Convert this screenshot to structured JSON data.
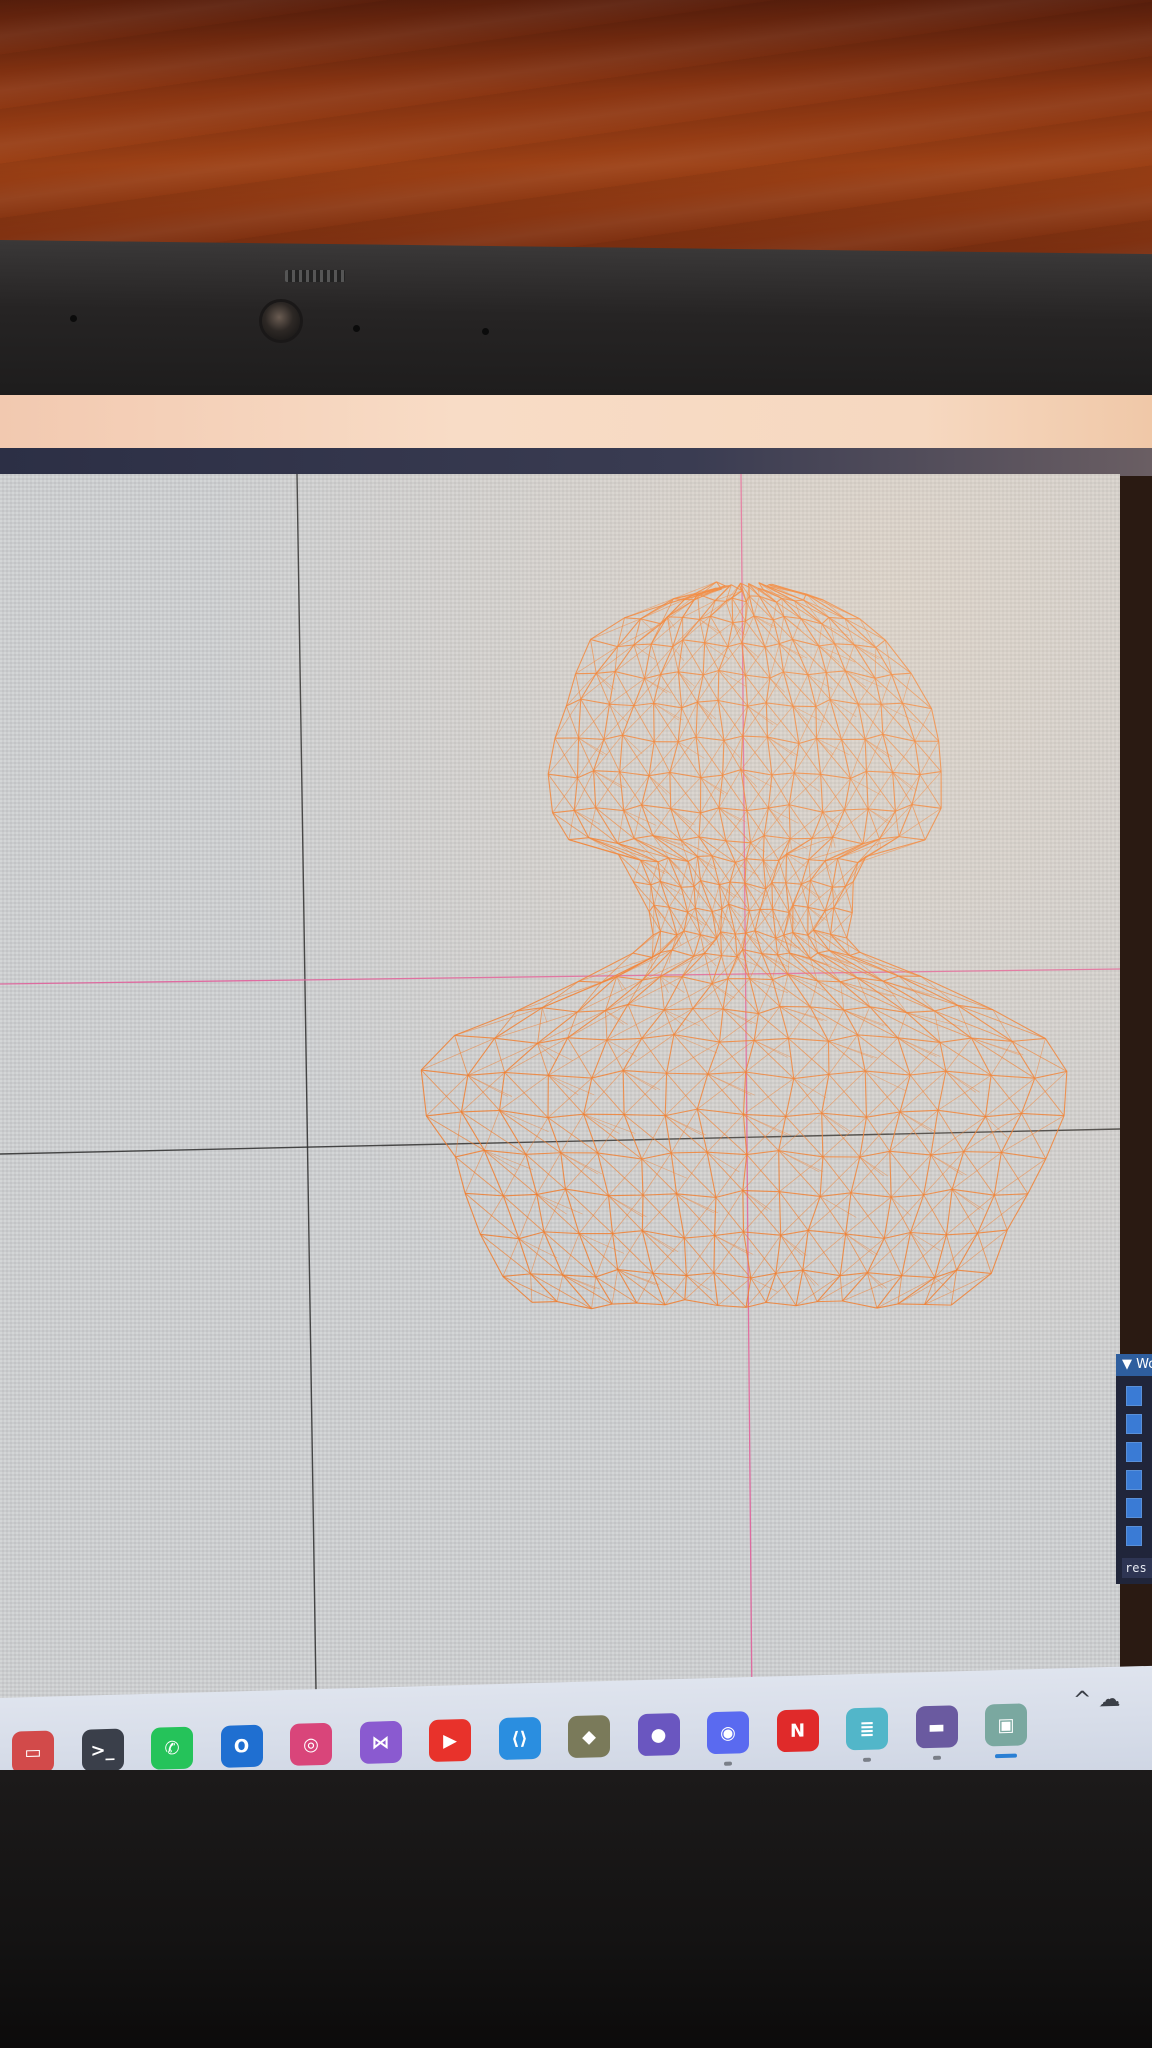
{
  "photo": {
    "desk_color": "#8a3512",
    "bezel_color": "#232121"
  },
  "viewport": {
    "background": "#cfd1d3",
    "grid_color": "#2b2b2b",
    "axis_color": "#e0609a",
    "mesh_color": "#f07a2a",
    "mesh_subject": "wireframe bust"
  },
  "imgui_window": {
    "title": "Wo",
    "checkbox_count": 6,
    "input_text": "res"
  },
  "taskbar": {
    "icons": [
      {
        "name": "window-app-icon",
        "glyph": "▭",
        "color": "#d24a4a",
        "running": false
      },
      {
        "name": "terminal-icon",
        "glyph": ">_",
        "color": "#3a3f4a",
        "running": false
      },
      {
        "name": "whatsapp-icon",
        "glyph": "✆",
        "color": "#25c35a",
        "running": false
      },
      {
        "name": "outlook-icon",
        "glyph": "O",
        "color": "#1f6fd1",
        "running": false
      },
      {
        "name": "instagram-icon",
        "glyph": "◎",
        "color": "#d9457a",
        "running": false
      },
      {
        "name": "visual-studio-icon",
        "glyph": "⋈",
        "color": "#8a5ad0",
        "running": true
      },
      {
        "name": "youtube-icon",
        "glyph": "▶",
        "color": "#e8322b",
        "running": false
      },
      {
        "name": "vscode-icon",
        "glyph": "⟨⟩",
        "color": "#2a8ee0",
        "running": false
      },
      {
        "name": "git-icon",
        "glyph": "◆",
        "color": "#7a7a5a",
        "running": false
      },
      {
        "name": "github-icon",
        "glyph": "●",
        "color": "#6a56c0",
        "running": false
      },
      {
        "name": "discord-icon",
        "glyph": "◉",
        "color": "#5a6af0",
        "running": true
      },
      {
        "name": "netflix-icon",
        "glyph": "N",
        "color": "#e02a2a",
        "running": false
      },
      {
        "name": "notepad-icon",
        "glyph": "≣",
        "color": "#52b6c9",
        "running": true
      },
      {
        "name": "terminal-window-icon",
        "glyph": "▬",
        "color": "#6a5aa0",
        "running": true
      },
      {
        "name": "app-window-icon",
        "glyph": "▣",
        "color": "#7aa8a0",
        "running": true
      }
    ],
    "tray": {
      "chevron": "^",
      "cloud": "☁"
    }
  }
}
